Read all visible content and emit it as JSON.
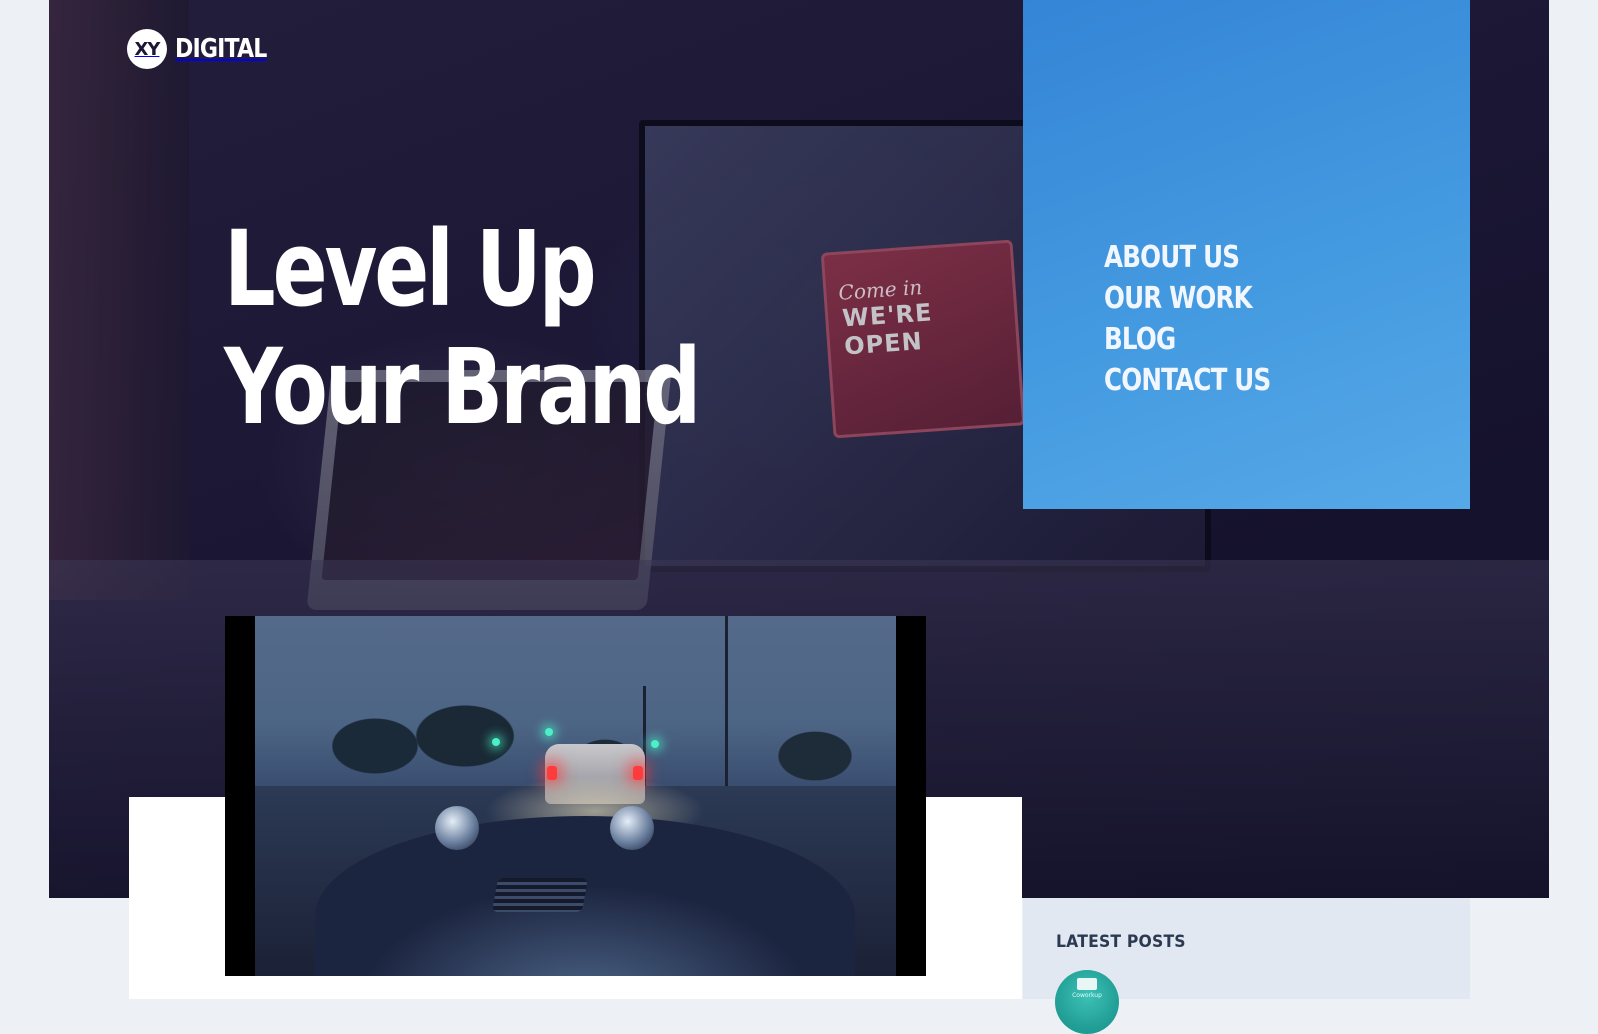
{
  "brand": {
    "badge": "XY",
    "name": "DIGITAL"
  },
  "hero": {
    "headline_line1": "Level Up",
    "headline_line2": "Your Brand",
    "sign_script": "Come in",
    "sign_text": "WE'RE OPEN"
  },
  "nav": {
    "items": [
      {
        "label": "ABOUT US"
      },
      {
        "label": "OUR WORK"
      },
      {
        "label": "BLOG"
      },
      {
        "label": "CONTACT US"
      }
    ]
  },
  "video": {
    "description_icon": "video-player"
  },
  "sidebar": {
    "title": "LATEST POSTS",
    "post_thumb_caption": "Coworkup"
  },
  "colors": {
    "page_bg": "#edf1f5",
    "hero_dark": "#1b1735",
    "nav_panel": "#449ae0",
    "sidebar_bg": "#e2e8f1",
    "text_white": "#ffffff"
  }
}
